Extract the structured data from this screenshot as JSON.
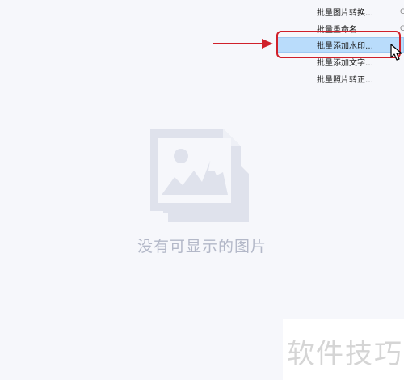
{
  "context_menu": {
    "items": [
      {
        "label": "批量图片转换…",
        "suffix": "C"
      },
      {
        "label": "批量重命名…",
        "suffix": "C"
      },
      {
        "label": "批量添加水印…",
        "suffix": ""
      },
      {
        "label": "批量添加文字…",
        "suffix": ""
      },
      {
        "label": "批量照片转正…",
        "suffix": ""
      }
    ],
    "highlighted_index": 2
  },
  "empty_state": {
    "message": "没有可显示的图片",
    "icon": "image-placeholder-icon"
  },
  "annotations": {
    "color": "#d0202a"
  },
  "watermark": {
    "text": "软件技巧"
  },
  "colors": {
    "background": "#f6f7fb",
    "highlight": "#b9dcfb",
    "placeholder": "#dfe2ec"
  }
}
